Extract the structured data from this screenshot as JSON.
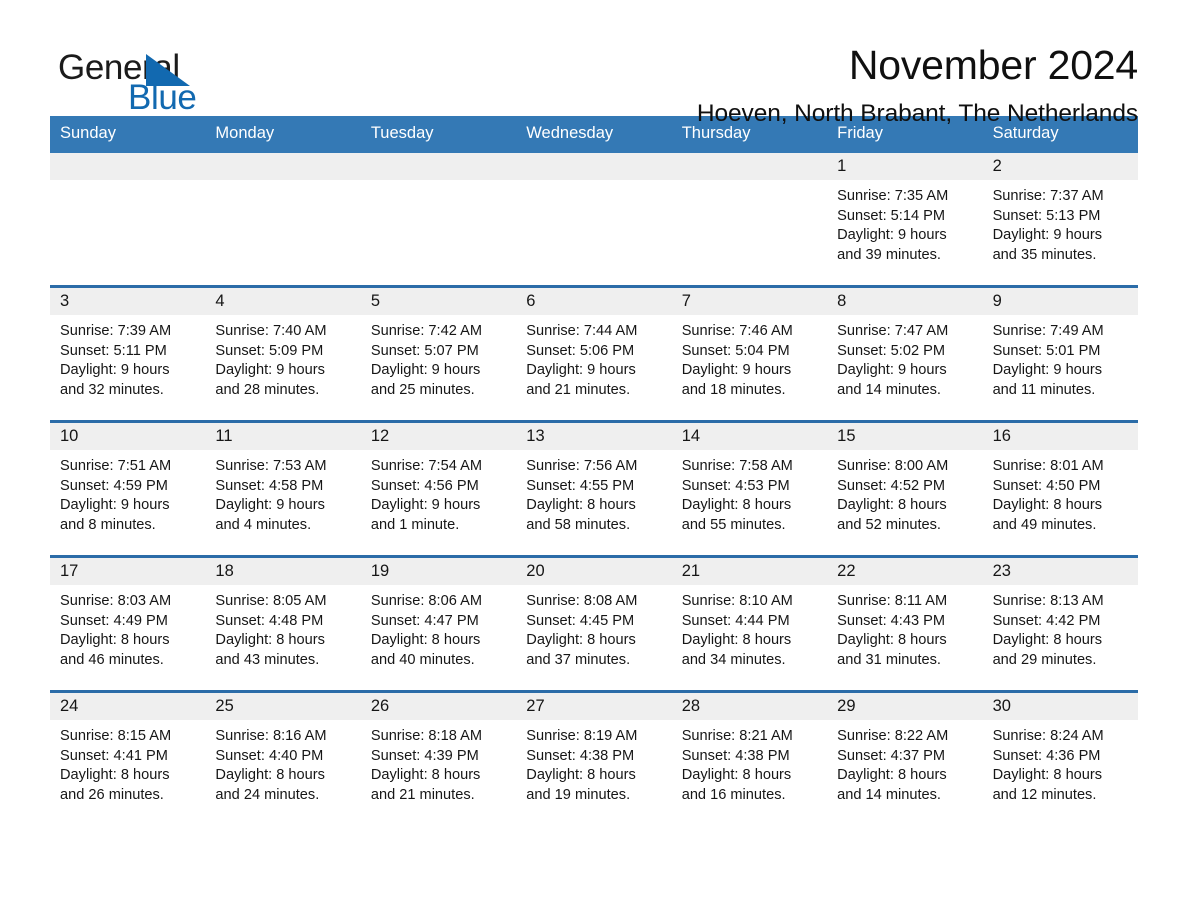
{
  "brand": {
    "name_part1": "General",
    "name_part2": "Blue",
    "triangle_icon": "triangle-icon",
    "blue_hex": "#1269b0"
  },
  "header": {
    "month_title": "November 2024",
    "location": "Hoeven, North Brabant, The Netherlands"
  },
  "theme": {
    "header_blue": "#3479b5",
    "row_divider_blue": "#2b6ca8",
    "daynum_band": "#efefef"
  },
  "weekday_headers": [
    "Sunday",
    "Monday",
    "Tuesday",
    "Wednesday",
    "Thursday",
    "Friday",
    "Saturday"
  ],
  "weeks": [
    [
      {
        "day": "",
        "sunrise": "",
        "sunset": "",
        "daylight1": "",
        "daylight2": ""
      },
      {
        "day": "",
        "sunrise": "",
        "sunset": "",
        "daylight1": "",
        "daylight2": ""
      },
      {
        "day": "",
        "sunrise": "",
        "sunset": "",
        "daylight1": "",
        "daylight2": ""
      },
      {
        "day": "",
        "sunrise": "",
        "sunset": "",
        "daylight1": "",
        "daylight2": ""
      },
      {
        "day": "",
        "sunrise": "",
        "sunset": "",
        "daylight1": "",
        "daylight2": ""
      },
      {
        "day": "1",
        "sunrise": "Sunrise: 7:35 AM",
        "sunset": "Sunset: 5:14 PM",
        "daylight1": "Daylight: 9 hours",
        "daylight2": "and 39 minutes."
      },
      {
        "day": "2",
        "sunrise": "Sunrise: 7:37 AM",
        "sunset": "Sunset: 5:13 PM",
        "daylight1": "Daylight: 9 hours",
        "daylight2": "and 35 minutes."
      }
    ],
    [
      {
        "day": "3",
        "sunrise": "Sunrise: 7:39 AM",
        "sunset": "Sunset: 5:11 PM",
        "daylight1": "Daylight: 9 hours",
        "daylight2": "and 32 minutes."
      },
      {
        "day": "4",
        "sunrise": "Sunrise: 7:40 AM",
        "sunset": "Sunset: 5:09 PM",
        "daylight1": "Daylight: 9 hours",
        "daylight2": "and 28 minutes."
      },
      {
        "day": "5",
        "sunrise": "Sunrise: 7:42 AM",
        "sunset": "Sunset: 5:07 PM",
        "daylight1": "Daylight: 9 hours",
        "daylight2": "and 25 minutes."
      },
      {
        "day": "6",
        "sunrise": "Sunrise: 7:44 AM",
        "sunset": "Sunset: 5:06 PM",
        "daylight1": "Daylight: 9 hours",
        "daylight2": "and 21 minutes."
      },
      {
        "day": "7",
        "sunrise": "Sunrise: 7:46 AM",
        "sunset": "Sunset: 5:04 PM",
        "daylight1": "Daylight: 9 hours",
        "daylight2": "and 18 minutes."
      },
      {
        "day": "8",
        "sunrise": "Sunrise: 7:47 AM",
        "sunset": "Sunset: 5:02 PM",
        "daylight1": "Daylight: 9 hours",
        "daylight2": "and 14 minutes."
      },
      {
        "day": "9",
        "sunrise": "Sunrise: 7:49 AM",
        "sunset": "Sunset: 5:01 PM",
        "daylight1": "Daylight: 9 hours",
        "daylight2": "and 11 minutes."
      }
    ],
    [
      {
        "day": "10",
        "sunrise": "Sunrise: 7:51 AM",
        "sunset": "Sunset: 4:59 PM",
        "daylight1": "Daylight: 9 hours",
        "daylight2": "and 8 minutes."
      },
      {
        "day": "11",
        "sunrise": "Sunrise: 7:53 AM",
        "sunset": "Sunset: 4:58 PM",
        "daylight1": "Daylight: 9 hours",
        "daylight2": "and 4 minutes."
      },
      {
        "day": "12",
        "sunrise": "Sunrise: 7:54 AM",
        "sunset": "Sunset: 4:56 PM",
        "daylight1": "Daylight: 9 hours",
        "daylight2": "and 1 minute."
      },
      {
        "day": "13",
        "sunrise": "Sunrise: 7:56 AM",
        "sunset": "Sunset: 4:55 PM",
        "daylight1": "Daylight: 8 hours",
        "daylight2": "and 58 minutes."
      },
      {
        "day": "14",
        "sunrise": "Sunrise: 7:58 AM",
        "sunset": "Sunset: 4:53 PM",
        "daylight1": "Daylight: 8 hours",
        "daylight2": "and 55 minutes."
      },
      {
        "day": "15",
        "sunrise": "Sunrise: 8:00 AM",
        "sunset": "Sunset: 4:52 PM",
        "daylight1": "Daylight: 8 hours",
        "daylight2": "and 52 minutes."
      },
      {
        "day": "16",
        "sunrise": "Sunrise: 8:01 AM",
        "sunset": "Sunset: 4:50 PM",
        "daylight1": "Daylight: 8 hours",
        "daylight2": "and 49 minutes."
      }
    ],
    [
      {
        "day": "17",
        "sunrise": "Sunrise: 8:03 AM",
        "sunset": "Sunset: 4:49 PM",
        "daylight1": "Daylight: 8 hours",
        "daylight2": "and 46 minutes."
      },
      {
        "day": "18",
        "sunrise": "Sunrise: 8:05 AM",
        "sunset": "Sunset: 4:48 PM",
        "daylight1": "Daylight: 8 hours",
        "daylight2": "and 43 minutes."
      },
      {
        "day": "19",
        "sunrise": "Sunrise: 8:06 AM",
        "sunset": "Sunset: 4:47 PM",
        "daylight1": "Daylight: 8 hours",
        "daylight2": "and 40 minutes."
      },
      {
        "day": "20",
        "sunrise": "Sunrise: 8:08 AM",
        "sunset": "Sunset: 4:45 PM",
        "daylight1": "Daylight: 8 hours",
        "daylight2": "and 37 minutes."
      },
      {
        "day": "21",
        "sunrise": "Sunrise: 8:10 AM",
        "sunset": "Sunset: 4:44 PM",
        "daylight1": "Daylight: 8 hours",
        "daylight2": "and 34 minutes."
      },
      {
        "day": "22",
        "sunrise": "Sunrise: 8:11 AM",
        "sunset": "Sunset: 4:43 PM",
        "daylight1": "Daylight: 8 hours",
        "daylight2": "and 31 minutes."
      },
      {
        "day": "23",
        "sunrise": "Sunrise: 8:13 AM",
        "sunset": "Sunset: 4:42 PM",
        "daylight1": "Daylight: 8 hours",
        "daylight2": "and 29 minutes."
      }
    ],
    [
      {
        "day": "24",
        "sunrise": "Sunrise: 8:15 AM",
        "sunset": "Sunset: 4:41 PM",
        "daylight1": "Daylight: 8 hours",
        "daylight2": "and 26 minutes."
      },
      {
        "day": "25",
        "sunrise": "Sunrise: 8:16 AM",
        "sunset": "Sunset: 4:40 PM",
        "daylight1": "Daylight: 8 hours",
        "daylight2": "and 24 minutes."
      },
      {
        "day": "26",
        "sunrise": "Sunrise: 8:18 AM",
        "sunset": "Sunset: 4:39 PM",
        "daylight1": "Daylight: 8 hours",
        "daylight2": "and 21 minutes."
      },
      {
        "day": "27",
        "sunrise": "Sunrise: 8:19 AM",
        "sunset": "Sunset: 4:38 PM",
        "daylight1": "Daylight: 8 hours",
        "daylight2": "and 19 minutes."
      },
      {
        "day": "28",
        "sunrise": "Sunrise: 8:21 AM",
        "sunset": "Sunset: 4:38 PM",
        "daylight1": "Daylight: 8 hours",
        "daylight2": "and 16 minutes."
      },
      {
        "day": "29",
        "sunrise": "Sunrise: 8:22 AM",
        "sunset": "Sunset: 4:37 PM",
        "daylight1": "Daylight: 8 hours",
        "daylight2": "and 14 minutes."
      },
      {
        "day": "30",
        "sunrise": "Sunrise: 8:24 AM",
        "sunset": "Sunset: 4:36 PM",
        "daylight1": "Daylight: 8 hours",
        "daylight2": "and 12 minutes."
      }
    ]
  ]
}
